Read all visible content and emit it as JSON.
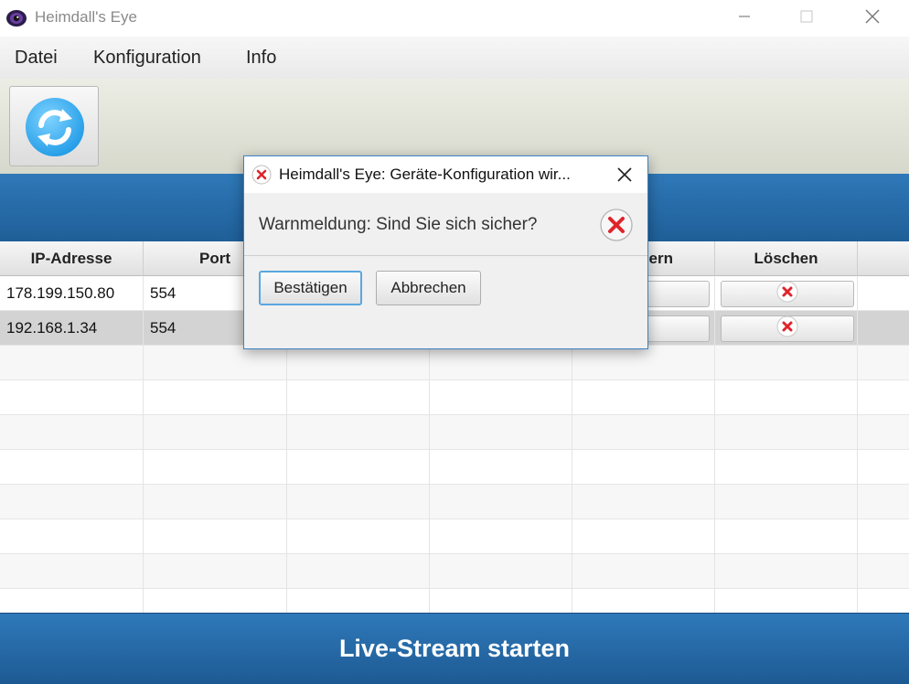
{
  "window": {
    "title": "Heimdall's Eye",
    "icons": {
      "app": "eye-icon",
      "minimize": "minimize-icon",
      "maximize": "maximize-icon",
      "close": "close-icon"
    }
  },
  "menu": {
    "items": [
      "Datei",
      "Konfiguration",
      "Info"
    ]
  },
  "toolbar": {
    "refresh_icon": "refresh-icon"
  },
  "table": {
    "columns": [
      "IP-Adresse",
      "Port",
      "",
      "",
      "Ändern",
      "Löschen"
    ],
    "rows": [
      {
        "ip": "178.199.150.80",
        "port": "554"
      },
      {
        "ip": "192.168.1.34",
        "port": "554"
      }
    ],
    "row_icons": {
      "edit": "edit-icon",
      "delete": "delete-icon"
    }
  },
  "dialog": {
    "title": "Heimdall's Eye: Geräte-Konfiguration wir...",
    "message": "Warnmeldung: Sind Sie sich sicher?",
    "confirm_label": "Bestätigen",
    "cancel_label": "Abbrechen",
    "icons": {
      "title": "error-icon",
      "close": "close-icon",
      "message": "error-icon"
    }
  },
  "footer": {
    "live_button_label": "Live-Stream starten"
  },
  "colors": {
    "accent": "#2A6FAE",
    "selected_row": "#D3D3D3",
    "error": "#E0242B"
  }
}
